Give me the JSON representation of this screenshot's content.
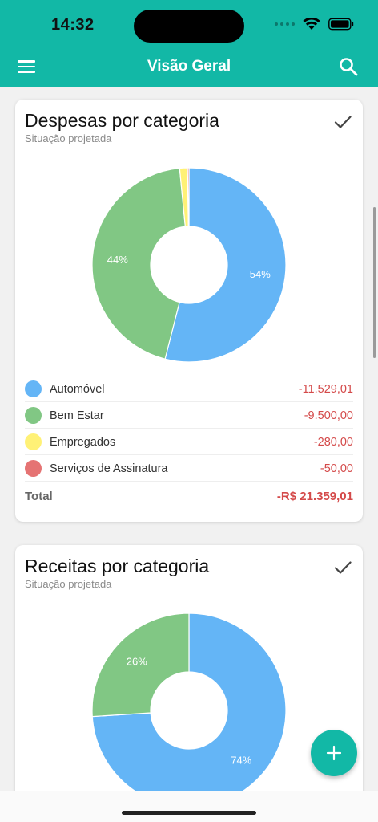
{
  "status_bar": {
    "time": "14:32"
  },
  "app_bar": {
    "title": "Visão Geral"
  },
  "expenses_card": {
    "title": "Despesas por categoria",
    "subtitle": "Situação projetada",
    "chart_data": {
      "type": "pie",
      "categories": [
        "Automóvel",
        "Bem Estar",
        "Empregados",
        "Serviços de Assinatura"
      ],
      "values": [
        11529.01,
        9500.0,
        280.0,
        50.0
      ],
      "percent_labels": [
        "54%",
        "44%",
        "",
        ""
      ],
      "colors": [
        "#64b5f6",
        "#81c784",
        "#fff176",
        "#e57373"
      ]
    },
    "legend": [
      {
        "label": "Automóvel",
        "value": "-11.529,01",
        "color": "#64b5f6"
      },
      {
        "label": "Bem Estar",
        "value": "-9.500,00",
        "color": "#81c784"
      },
      {
        "label": "Empregados",
        "value": "-280,00",
        "color": "#fff176"
      },
      {
        "label": "Serviços de Assinatura",
        "value": "-50,00",
        "color": "#e57373"
      }
    ],
    "total_label": "Total",
    "total_value": "-R$ 21.359,01"
  },
  "income_card": {
    "title": "Receitas por categoria",
    "subtitle": "Situação projetada",
    "chart_data": {
      "type": "pie",
      "categories": [
        "",
        ""
      ],
      "values": [
        74,
        26
      ],
      "percent_labels": [
        "74%",
        "26%"
      ],
      "colors": [
        "#64b5f6",
        "#81c784"
      ]
    }
  },
  "fab": {
    "icon": "plus-icon"
  },
  "theme": {
    "primary": "#12b8a6",
    "negative": "#d44a4a"
  }
}
